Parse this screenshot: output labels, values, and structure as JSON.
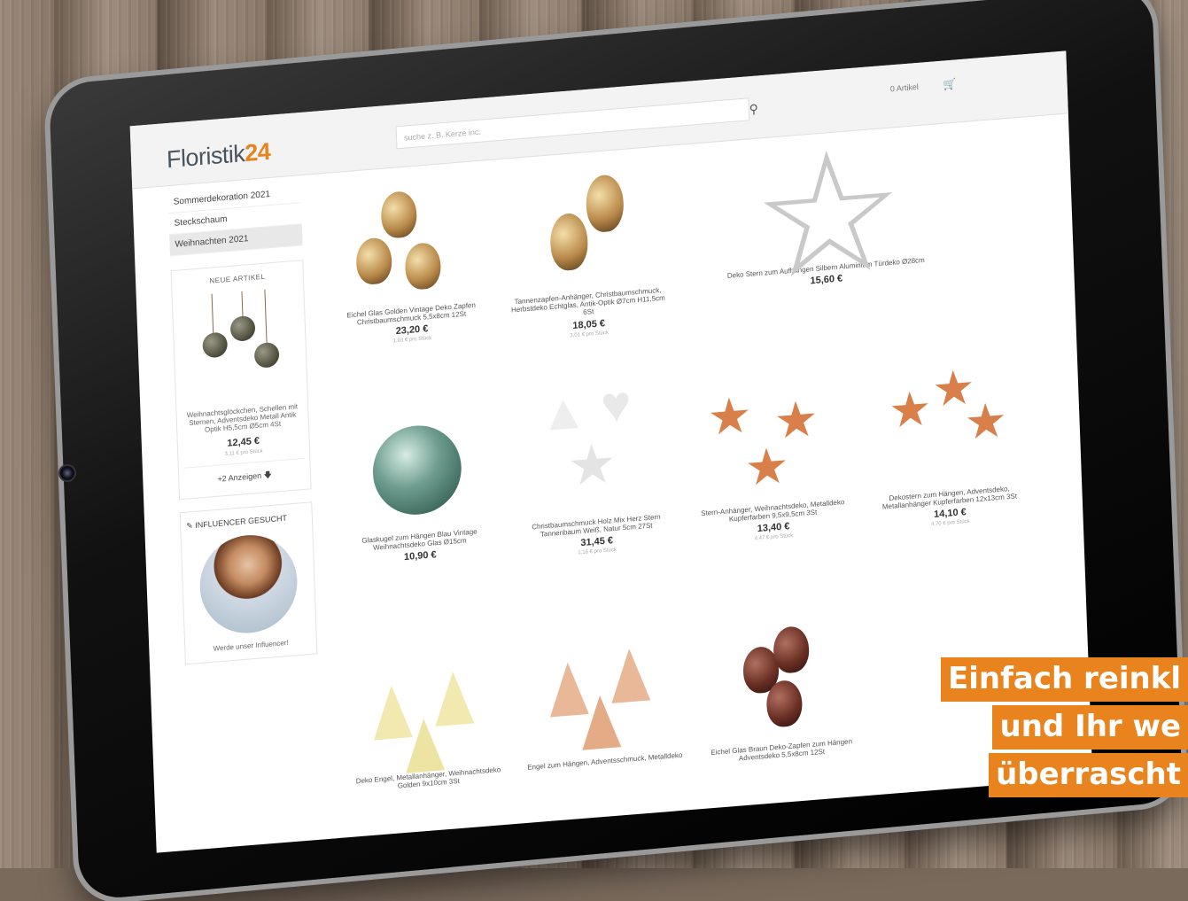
{
  "header": {
    "logo_text": "Floristik",
    "logo_num": "24",
    "search_placeholder": "suche z. B. Kerze inc.",
    "cart_count": "0 Artikel"
  },
  "sidebar": {
    "categories": [
      "Sommerdekoration 2021",
      "Steckschaum",
      "Weihnachten 2021"
    ],
    "new_items_title": "NEUE ARTIKEL",
    "new_item_name": "Weihnachtsglöckchen, Schellen mit Sternen, Adventsdeko Metall Antik Optik H5,5cm Ø5cm 4St",
    "new_item_price": "12,45 €",
    "new_item_unit": "3,11 € pro Stück",
    "more_button": "+2 Anzeigen",
    "influencer_title": "INFLUENCER GESUCHT",
    "influencer_link": "Werde unser Influencer!"
  },
  "products": [
    {
      "name": "Eichel Glas Golden Vintage Deko Zapfen Christbaumschmuck 5,5x8cm 12St",
      "price": "23,20 €",
      "unit": "1,93 € pro Stück"
    },
    {
      "name": "Tannenzapfen-Anhänger, Christbaumschmuck, Herbstdeko Echtglas, Antik-Optik Ø7cm H11,5cm 6St",
      "price": "18,05 €",
      "unit": "3,01 € pro Stück"
    },
    {
      "name": "Deko Stern zum Aufhängen Silbern Aluminium Türdeko Ø28cm",
      "price": "15,60 €",
      "unit": ""
    },
    {
      "name": "Glaskugel zum Hängen Blau Vintage Weihnachtsdeko Glas Ø15cm",
      "price": "10,90 €",
      "unit": ""
    },
    {
      "name": "Christbaumschmuck Holz Mix Herz Stern Tannenbaum Weiß, Natur 5cm 27St",
      "price": "31,45 €",
      "unit": "1,16 € pro Stück"
    },
    {
      "name": "Stern-Anhänger, Weihnachtsdeko, Metalldeko Kupferfarben 9,5x9,5cm 3St",
      "price": "13,40 €",
      "unit": "4,47 € pro Stück"
    },
    {
      "name": "Dekostern zum Hängen, Adventsdeko, Metallanhänger Kupferfarben 12x13cm 3St",
      "price": "14,10 €",
      "unit": "4,70 € pro Stück"
    },
    {
      "name": "Deko Engel, Metallanhänger, Weihnachtsdeko Golden 9x10cm 3St",
      "price": "",
      "unit": ""
    },
    {
      "name": "Engel zum Hängen, Adventsschmuck, Metalldeko",
      "price": "",
      "unit": ""
    },
    {
      "name": "Eichel Glas Braun Deko-Zapfen zum Hängen Adventsdeko 5,5x8cm 12St",
      "price": "",
      "unit": ""
    }
  ],
  "banner": {
    "line1": "Einfach reinkl",
    "line2": "und Ihr we",
    "line3": "überrascht"
  },
  "colors": {
    "accent": "#e8831e",
    "wood": "#8a7868"
  },
  "icons": [
    "search-icon",
    "cart-icon",
    "arrow-down-icon",
    "pencil-icon"
  ]
}
